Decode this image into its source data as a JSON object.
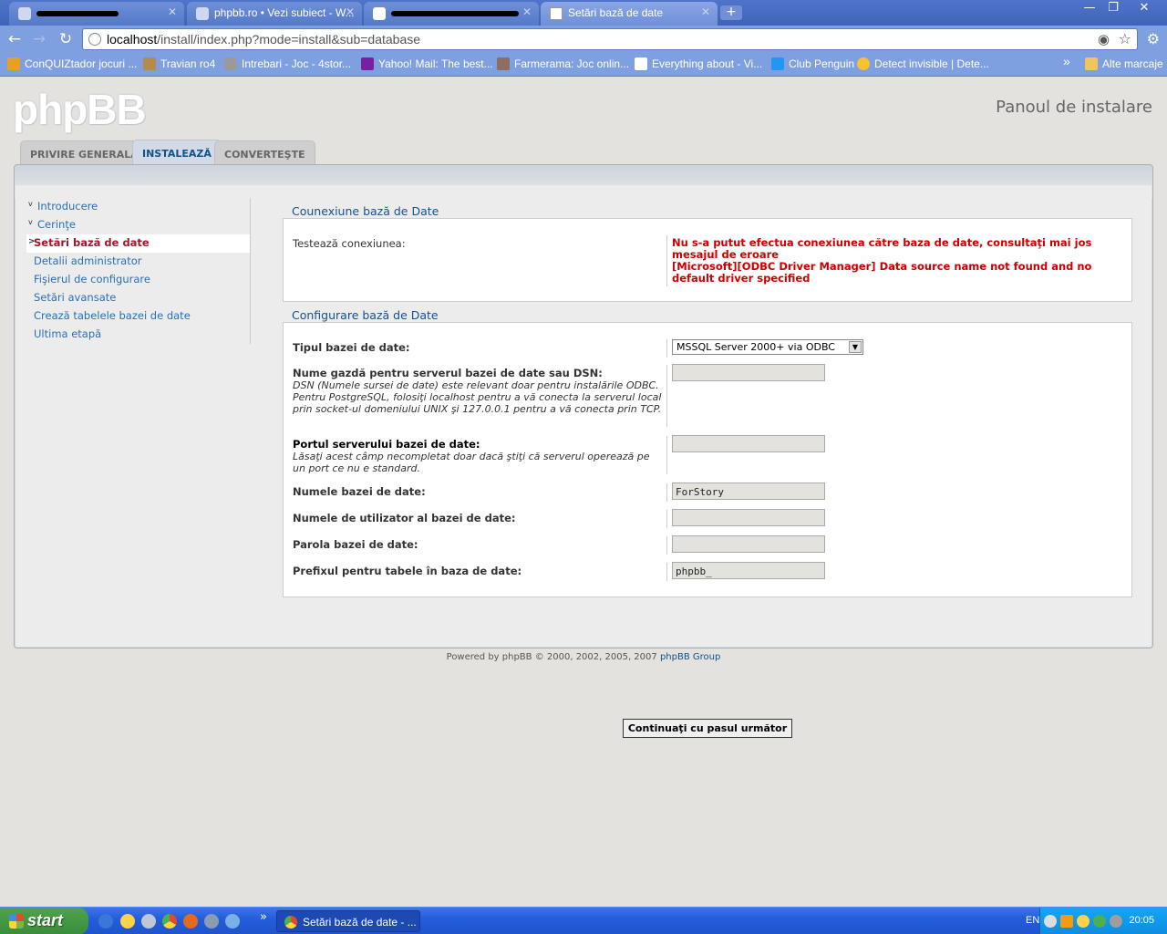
{
  "browser": {
    "tabs": [
      {
        "label": "",
        "redacted": true
      },
      {
        "label": "phpbb.ro • Vezi subiect - W...",
        "redacted": false
      },
      {
        "label": "",
        "redacted": true
      },
      {
        "label": "Setări bază de date",
        "redacted": false
      }
    ],
    "new_tab_label": "+",
    "window_controls": {
      "minimize": "—",
      "restore": "❐",
      "close": "✕"
    },
    "url_host": "localhost",
    "url_path": "/install/index.php?mode=install&sub=database",
    "bookmarks": [
      {
        "label": "ConQUIZtador jocuri ...",
        "color": "#e8a020"
      },
      {
        "label": "Travian ro4",
        "color": "#b58a4a"
      },
      {
        "label": "Intrebari - Joc - 4stor...",
        "color": "#9a9a9a"
      },
      {
        "label": "Yahoo! Mail: The best...",
        "color": "#7b1fa2"
      },
      {
        "label": "Farmerama: Joc onlin...",
        "color": "#8d6e63"
      },
      {
        "label": "Everything about - Vi...",
        "color": "#ffffff"
      },
      {
        "label": "Club Penguin",
        "color": "#2196f3"
      },
      {
        "label": "Detect invisible | Dete...",
        "color": "#fbc02d"
      }
    ],
    "bookmarks_more": "»",
    "other_bookmarks": "Alte marcaje"
  },
  "site": {
    "logo": "phpBB",
    "panel_title": "Panoul de instalare",
    "tabs": [
      {
        "label": "PRIVIRE GENERALĂ",
        "active": false
      },
      {
        "label": "INSTALEAZĂ",
        "active": true
      },
      {
        "label": "CONVERTEŞTE",
        "active": false
      }
    ],
    "menu": [
      {
        "label": "Introducere",
        "state": "done"
      },
      {
        "label": "Cerinţe",
        "state": "done"
      },
      {
        "label": "Setări bază de date",
        "state": "current"
      },
      {
        "label": "Detalii administrator",
        "state": "todo"
      },
      {
        "label": "Fişierul de configurare",
        "state": "todo"
      },
      {
        "label": "Setări avansate",
        "state": "todo"
      },
      {
        "label": "Crează tabelele bazei de date",
        "state": "todo"
      },
      {
        "label": "Ultima etapă",
        "state": "todo"
      }
    ],
    "connection": {
      "legend": "Counexiune bază de Date",
      "test_label": "Testează conexiunea:",
      "error_line1": "Nu s-a putut efectua conexiunea către baza de date, consultaţi mai jos mesajul de eroare",
      "error_line2": "[Microsoft][ODBC Driver Manager] Data source name not found and no default driver specified"
    },
    "config": {
      "legend": "Configurare bază de Date",
      "dbtype_label": "Tipul bazei de date:",
      "dbtype_value": "MSSQL Server 2000+ via ODBC",
      "host_label": "Nume gazdă pentru serverul bazei de date sau DSN:",
      "host_help": "DSN (Numele sursei de date) este relevant doar pentru instalările ODBC. Pentru PostgreSQL, folosiţi localhost pentru a vă conecta la serverul local prin socket-ul domeniului UNIX şi 127.0.0.1 pentru a vă conecta prin TCP.",
      "host_value": "",
      "port_label": "Portul serverului bazei de date:",
      "port_help": "Lăsaţi acest câmp necompletat doar dacă ştiţi că serverul operează pe un port ce nu e standard.",
      "port_value": "",
      "dbname_label": "Numele bazei de date:",
      "dbname_value": "ForStory",
      "user_label": "Numele de utilizator al bazei de date:",
      "user_value": "",
      "pass_label": "Parola bazei de date:",
      "pass_value": "",
      "prefix_label": "Prefixul pentru tabele în baza de date:",
      "prefix_value": "phpbb_"
    },
    "continue_button": "Continuaţi cu pasul următor",
    "footer_text": "Powered by phpBB © 2000, 2002, 2005, 2007",
    "footer_link": "phpBB Group"
  },
  "taskbar": {
    "start_label": "start",
    "quicklaunch_more": "»",
    "task_item": "Setări bază de date - ...",
    "language": "EN",
    "clock": "20:05"
  }
}
